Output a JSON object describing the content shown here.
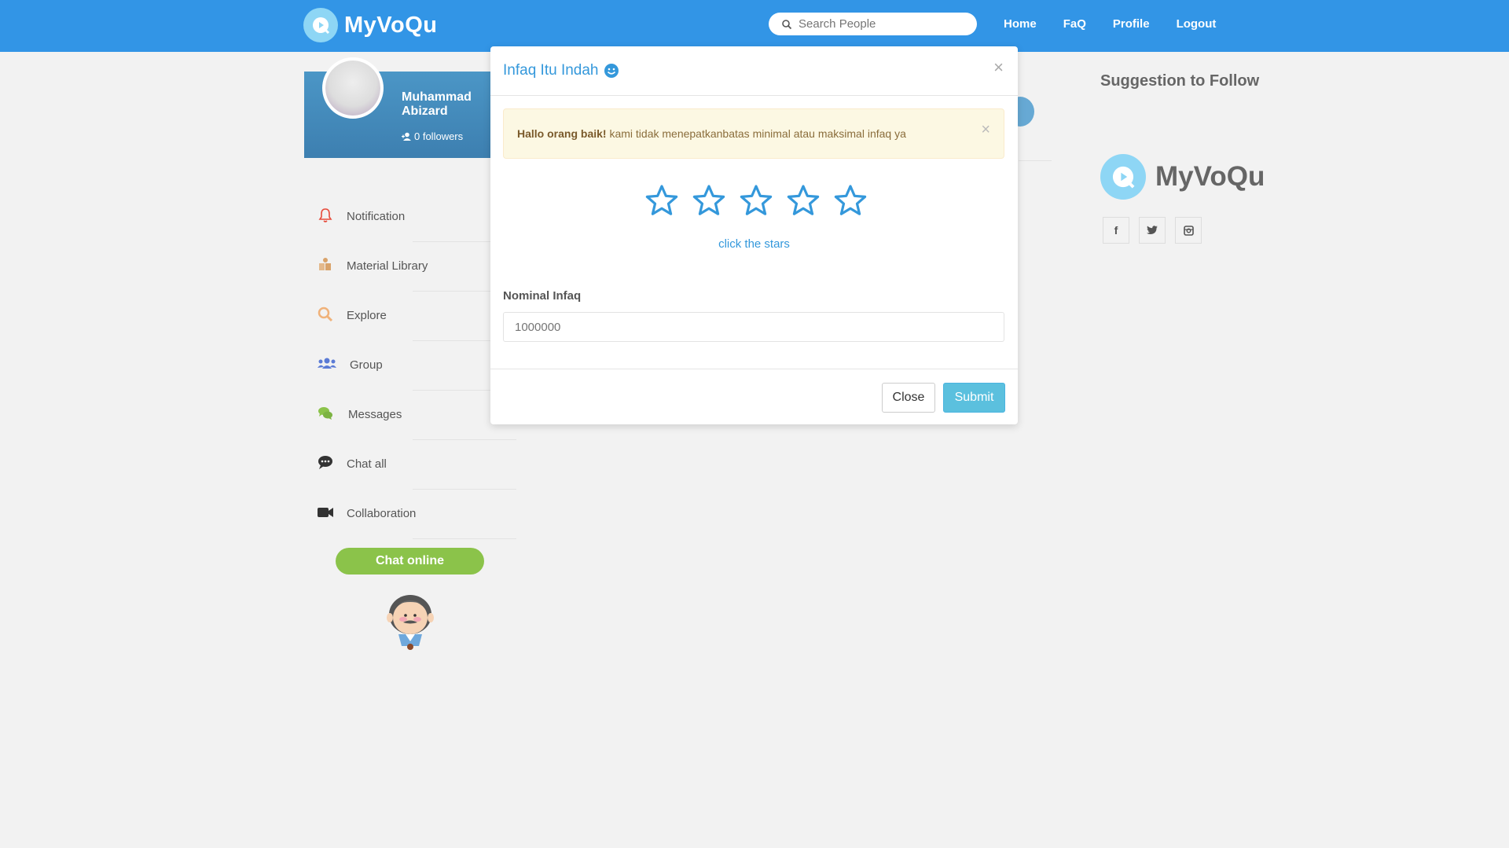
{
  "navbar": {
    "brand": "MyVoQu",
    "search_placeholder": "Search People",
    "links": [
      "Home",
      "FaQ",
      "Profile",
      "Logout"
    ]
  },
  "profile": {
    "name": "Muhammad Abizard",
    "followers": "0 followers"
  },
  "sidebar": {
    "items": [
      {
        "label": "Notification",
        "icon": "bell-icon",
        "color": "#e74c3c"
      },
      {
        "label": "Material Library",
        "icon": "book-icon",
        "color": "#d9a36b"
      },
      {
        "label": "Explore",
        "icon": "search-icon",
        "color": "#f0b27a"
      },
      {
        "label": "Group",
        "icon": "users-icon",
        "color": "#5b7bd5"
      },
      {
        "label": "Messages",
        "icon": "comments-icon",
        "color": "#8bc34a"
      },
      {
        "label": "Chat all",
        "icon": "comment-dots-icon",
        "color": "#333333"
      },
      {
        "label": "Collaboration",
        "icon": "video-camera-icon",
        "color": "#333333"
      }
    ],
    "chat_online": "Chat online"
  },
  "right": {
    "suggestion_title": "Suggestion to Follow",
    "brand": "MyVoQu",
    "socials": [
      "f",
      "twitter-icon",
      "instagram-icon"
    ]
  },
  "modal": {
    "title": "Infaq Itu Indah",
    "alert_bold": "Hallo orang baik!",
    "alert_text": "kami tidak menepatkanbatas minimal atau maksimal infaq ya",
    "rating": 0,
    "stars_count": 5,
    "stars_hint": "click the stars",
    "field_label": "Nominal Infaq",
    "field_placeholder": "1000000",
    "close_label": "Close",
    "submit_label": "Submit"
  },
  "colors": {
    "navbar": "#3295e6",
    "accent": "#3498db",
    "chat_online": "#8bc34a",
    "submit": "#5bc0de"
  }
}
